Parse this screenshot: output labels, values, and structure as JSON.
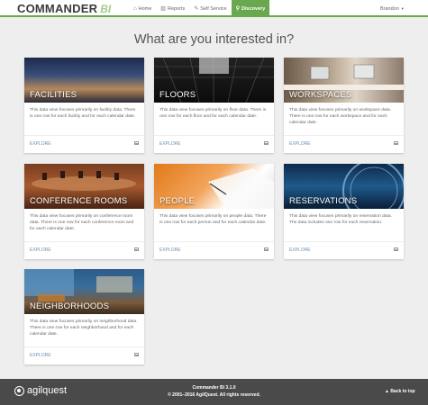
{
  "header": {
    "brand_name": "COMMANDER",
    "brand_suffix": "BI",
    "nav": [
      {
        "label": "Home",
        "icon": "home-icon"
      },
      {
        "label": "Reports",
        "icon": "bar-chart-icon"
      },
      {
        "label": "Self Service",
        "icon": "wrench-icon"
      },
      {
        "label": "Discovery",
        "icon": "search-icon",
        "active": true
      }
    ],
    "user": "Brandon"
  },
  "main": {
    "title": "What are you interested in?",
    "explore_label": "EXPLORE",
    "cards": [
      {
        "title": "FACILITIES",
        "description": "This data view focuses primarily on facility data. There is one row for each facility and for each calendar date."
      },
      {
        "title": "FLOORS",
        "description": "This data view focuses primarily on floor data. There is one row for each floor and for each calendar date."
      },
      {
        "title": "WORKSPACES",
        "description": "This data view focuses primarily on workspace data. There is one row for each workspace and for each calendar date."
      },
      {
        "title": "CONFERENCE ROOMS",
        "description": "This data view focuses primarily on conference room data. There is one row for each conference room and for each calendar date."
      },
      {
        "title": "PEOPLE",
        "description": "This data view focuses primarily on people data. There is one row for each person and for each calendar date."
      },
      {
        "title": "RESERVATIONS",
        "description": "This data view focuses primarily on reservation data. The data includes one row for each reservation."
      },
      {
        "title": "NEIGHBORHOODS",
        "description": "This data view focuses primarily on neighborhood data. There is one row for each neighborhood and for each calendar date."
      }
    ]
  },
  "footer": {
    "logo_text": "agilquest",
    "version": "Commander BI 3.1.0",
    "copyright": "© 2001–2016 AgilQuest. All rights reserved.",
    "back_to_top": "Back to top"
  },
  "colors": {
    "accent": "#6aa84f",
    "footer_bg": "#4a4a4a",
    "link": "#6b8fb3"
  }
}
